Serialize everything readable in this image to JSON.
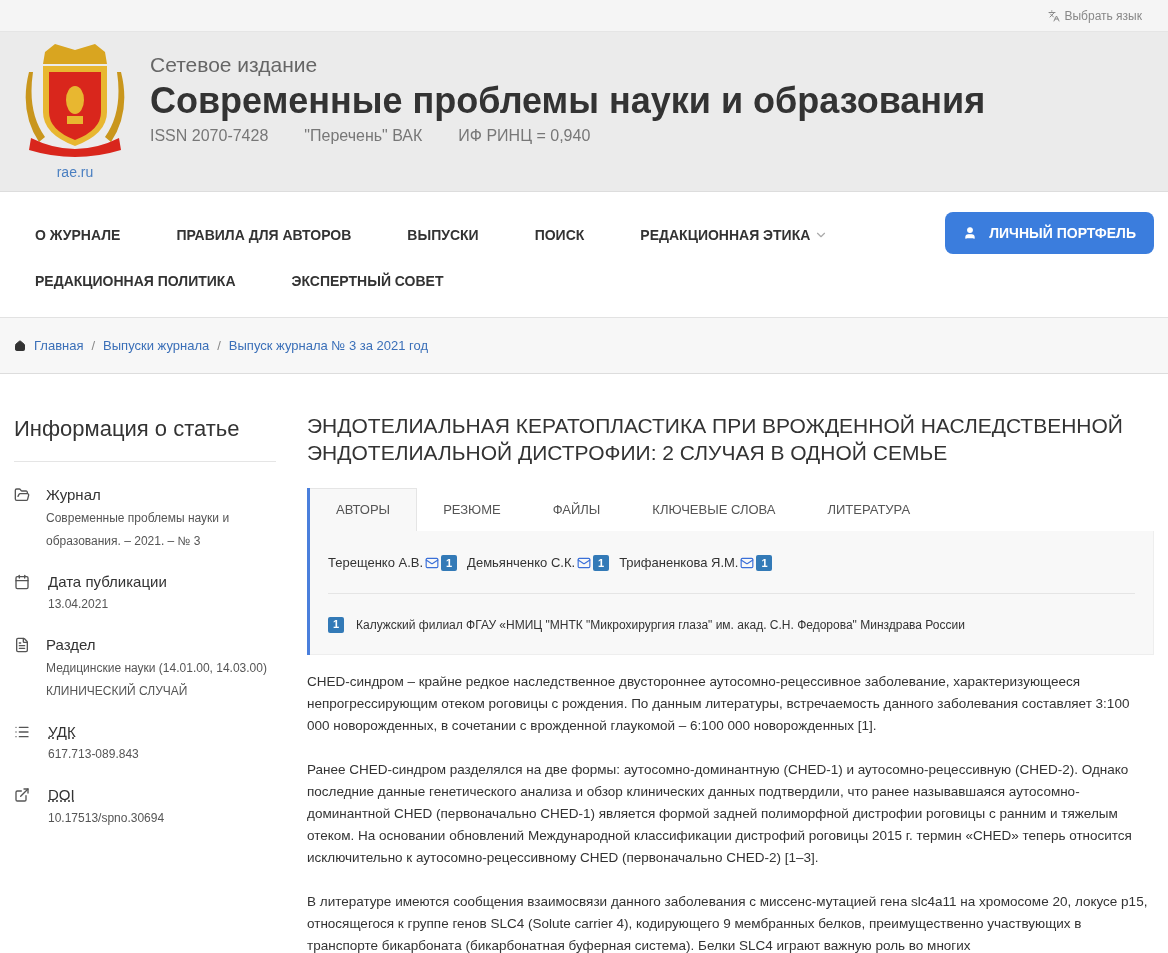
{
  "topbar": {
    "language": "Выбрать язык"
  },
  "header": {
    "logo_caption": "rae.ru",
    "subtitle": "Сетевое издание",
    "title": "Современные проблемы науки и образования",
    "meta": [
      "ISSN 2070-7428",
      "\"Перечень\" ВАК",
      "ИФ РИНЦ = 0,940"
    ]
  },
  "nav": {
    "items": [
      {
        "label": "О ЖУРНАЛЕ",
        "dropdown": false
      },
      {
        "label": "ПРАВИЛА ДЛЯ АВТОРОВ",
        "dropdown": false
      },
      {
        "label": "ВЫПУСКИ",
        "dropdown": false
      },
      {
        "label": "ПОИСК",
        "dropdown": false
      },
      {
        "label": "РЕДАКЦИОННАЯ ЭТИКА",
        "dropdown": true
      },
      {
        "label": "РЕДАКЦИОННАЯ ПОЛИТИКА",
        "dropdown": false
      },
      {
        "label": "ЭКСПЕРТНЫЙ СОВЕТ",
        "dropdown": false
      }
    ],
    "portfolio_button": "ЛИЧНЫЙ ПОРТФЕЛЬ"
  },
  "breadcrumb_separator": "/",
  "breadcrumbs": [
    "Главная",
    "Выпуски журнала",
    "Выпуск журнала № 3 за 2021 год"
  ],
  "sidebar": {
    "title": "Информация о статье",
    "items": [
      {
        "label": "Журнал",
        "abbr": false,
        "value": "Современные проблемы науки и образования. – 2021. – № 3"
      },
      {
        "label": "Дата публикации",
        "abbr": false,
        "value": "13.04.2021"
      },
      {
        "label": "Раздел",
        "abbr": false,
        "value": "Медицинские науки (14.01.00, 14.03.00) КЛИНИЧЕСКИЙ СЛУЧАЙ"
      },
      {
        "label": "УДК",
        "abbr": true,
        "value": "617.713-089.843"
      },
      {
        "label": "DOI",
        "abbr": true,
        "value": "10.17513/spno.30694"
      }
    ]
  },
  "article": {
    "title": "ЭНДОТЕЛИАЛЬНАЯ КЕРАТОПЛАСТИКА ПРИ ВРОЖДЕННОЙ НАСЛЕДСТВЕННОЙ ЭНДОТЕЛИАЛЬНОЙ ДИСТРОФИИ: 2 СЛУЧАЯ В ОДНОЙ СЕМЬЕ",
    "tabs": [
      {
        "label": "АВТОРЫ",
        "selected": true
      },
      {
        "label": "РЕЗЮМЕ",
        "selected": false
      },
      {
        "label": "ФАЙЛЫ",
        "selected": false
      },
      {
        "label": "КЛЮЧЕВЫЕ СЛОВА",
        "selected": false
      },
      {
        "label": "ЛИТЕРАТУРА",
        "selected": false
      }
    ],
    "authors": [
      {
        "name": "Терещенко А.В.",
        "affiliation": "1"
      },
      {
        "name": "Демьянченко С.К.",
        "affiliation": "1"
      },
      {
        "name": "Трифаненкова Я.М.",
        "affiliation": "1"
      }
    ],
    "affiliations": [
      {
        "number": "1",
        "text": "Калужский филиал ФГАУ «НМИЦ \"МНТК \"Микрохирургия глаза\" им. акад. С.Н. Федорова\" Минздрава России"
      }
    ],
    "paragraphs": [
      "CHED-синдром – крайне редкое наследственное двустороннее аутосомно-рецессивное заболевание, характеризующееся непрогрессирующим отеком роговицы с рождения. По данным литературы, встречаемость данного заболевания составляет 3:100 000 новорожденных, в сочетании с врожденной глаукомой – 6:100 000 новорожденных [1].",
      "Ранее CHED-синдром разделялся на две формы: аутосомно-доминантную (CHED-1) и аутосомно-рецессивную (CHED-2). Однако последние данные генетического анализа и обзор клинических данных подтвердили, что ранее называвшаяся аутосомно-доминантной CHED (первоначально CHED-1) является формой задней полиморфной дистрофии роговицы с ранним и тяжелым отеком. На основании обновлений Международной классификации дистрофий роговицы 2015 г. термин «CHED» теперь относится исключительно к аутосомно-рецессивному CHED (первоначально CHED-2) [1–3].",
      "В литературе имеются сообщения взаимосвязи данного заболевания с миссенс-мутацией гена slc4a11 на хромосоме 20, локусе p15, относящегося к группе генов SLC4 (Solute carrier 4), кодирующего 9 мембранных белков, преимущественно участвующих в транспорте бикарбоната (бикарбонатная буферная система). Белки SLC4 играют важную роль во многих"
    ]
  }
}
